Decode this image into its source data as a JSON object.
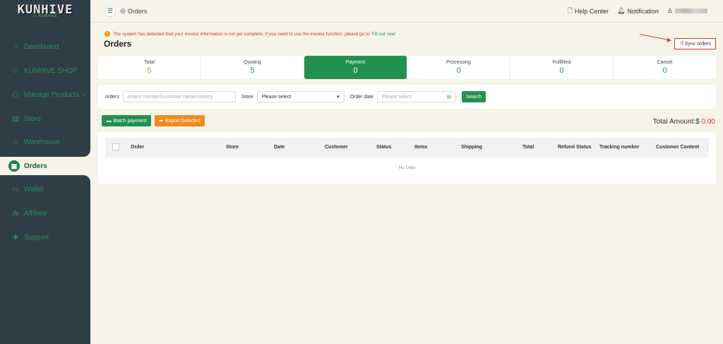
{
  "sidebar": {
    "logo_text": "KUNHIVE",
    "logo_sub": "— KUNHIVE",
    "items": [
      {
        "label": "Dashboard",
        "icon": "dashboard-icon"
      },
      {
        "label": "KUNHIVE SHOP",
        "icon": "shopping-bag-icon"
      },
      {
        "label": "Manage Products",
        "icon": "products-icon",
        "chevron": "›"
      },
      {
        "label": "Store",
        "icon": "store-icon"
      },
      {
        "label": "Warehouse",
        "icon": "warehouse-icon"
      },
      {
        "label": "Orders",
        "icon": "orders-icon"
      },
      {
        "label": "Wallet",
        "icon": "wallet-icon"
      },
      {
        "label": "Affiliate",
        "icon": "affiliate-icon"
      },
      {
        "label": "Support",
        "icon": "support-icon"
      }
    ]
  },
  "topbar": {
    "breadcrumb": "Orders",
    "help_center": "Help Center",
    "notification": "Notification"
  },
  "alert": {
    "text": "The system has detected that your invoice information is not yet complete. If you need to use the invoice function, please go to '",
    "link": "Fill out now",
    "suffix": "'"
  },
  "page": {
    "title": "Orders",
    "sync_label": "Sync orders"
  },
  "stats": [
    {
      "label": "Total",
      "value": "5"
    },
    {
      "label": "Quoting",
      "value": "5"
    },
    {
      "label": "Payment",
      "value": "0"
    },
    {
      "label": "Processing",
      "value": "0"
    },
    {
      "label": "Fullfilled",
      "value": "0"
    },
    {
      "label": "Cancel",
      "value": "0"
    }
  ],
  "filter": {
    "orders_label": "orders",
    "orders_placeholder": "orders number/customer name/country",
    "store_label": "Store",
    "store_value": "Please select",
    "date_label": "Order date",
    "date_placeholder": "Please select",
    "search_label": "Search"
  },
  "actions": {
    "batch_payment": "Batch payment",
    "export_selected": "Export Selected",
    "total_label": "Total Amount:$",
    "total_value": "0.00"
  },
  "table": {
    "columns": [
      "Order",
      "Store",
      "Date",
      "Customer",
      "Status",
      "Items",
      "Shipping",
      "Total",
      "Refund Status",
      "Tracking number",
      "Customer Content"
    ],
    "empty": "No Data"
  },
  "colors": {
    "sidebar_bg": "#2f3e46",
    "accent_green": "#229150",
    "accent_orange": "#f28b1e",
    "alert_red": "#d9342b",
    "page_bg": "#f6f3e8"
  }
}
